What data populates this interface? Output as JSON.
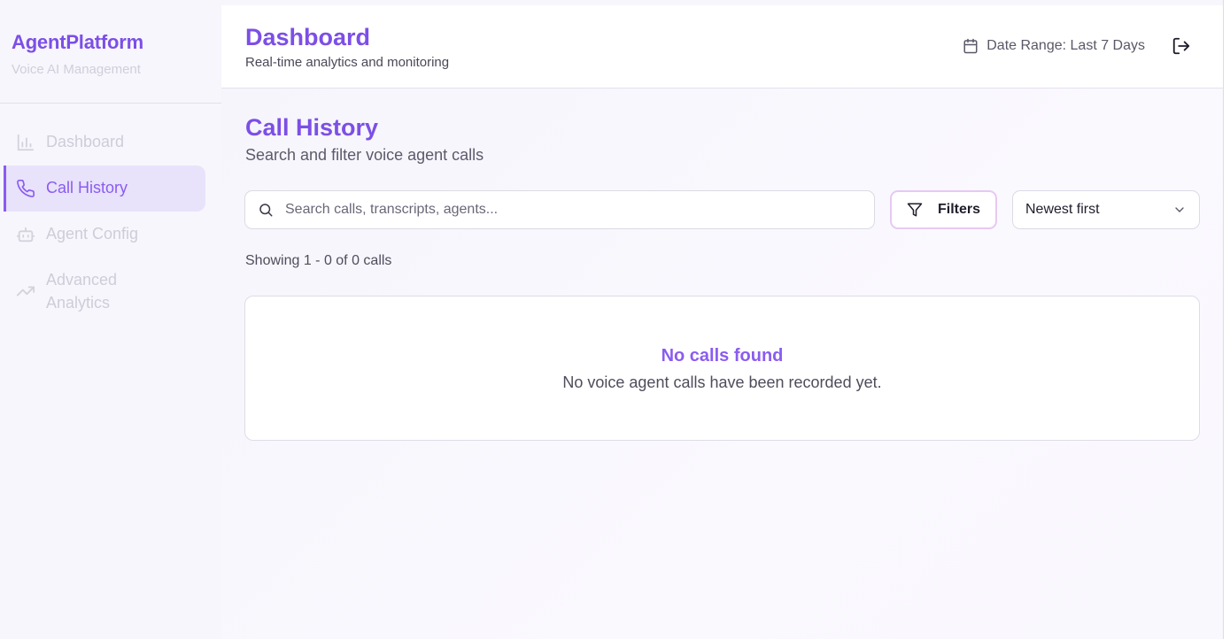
{
  "brand": {
    "title": "AgentPlatform",
    "subtitle": "Voice AI Management"
  },
  "sidebar": {
    "items": [
      {
        "label": "Dashboard",
        "icon": "bar-chart-icon",
        "active": false
      },
      {
        "label": "Call History",
        "icon": "phone-icon",
        "active": true
      },
      {
        "label": "Agent Config",
        "icon": "robot-icon",
        "active": false
      },
      {
        "label": "Advanced Analytics",
        "icon": "trending-up-icon",
        "active": false
      }
    ]
  },
  "header": {
    "title": "Dashboard",
    "subtitle": "Real-time analytics and monitoring",
    "date_range": "Date Range: Last 7 Days"
  },
  "main": {
    "title": "Call History",
    "subtitle": "Search and filter voice agent calls",
    "search_placeholder": "Search calls, transcripts, agents...",
    "filters_label": "Filters",
    "sort_value": "Newest first",
    "showing_text": "Showing 1 - 0 of 0 calls",
    "empty_title": "No calls found",
    "empty_desc": "No voice agent calls have been recorded yet."
  },
  "colors": {
    "accent": "#7c4fe6",
    "active_bg": "#e8e2fb",
    "filters_border": "#e6c9f4"
  }
}
